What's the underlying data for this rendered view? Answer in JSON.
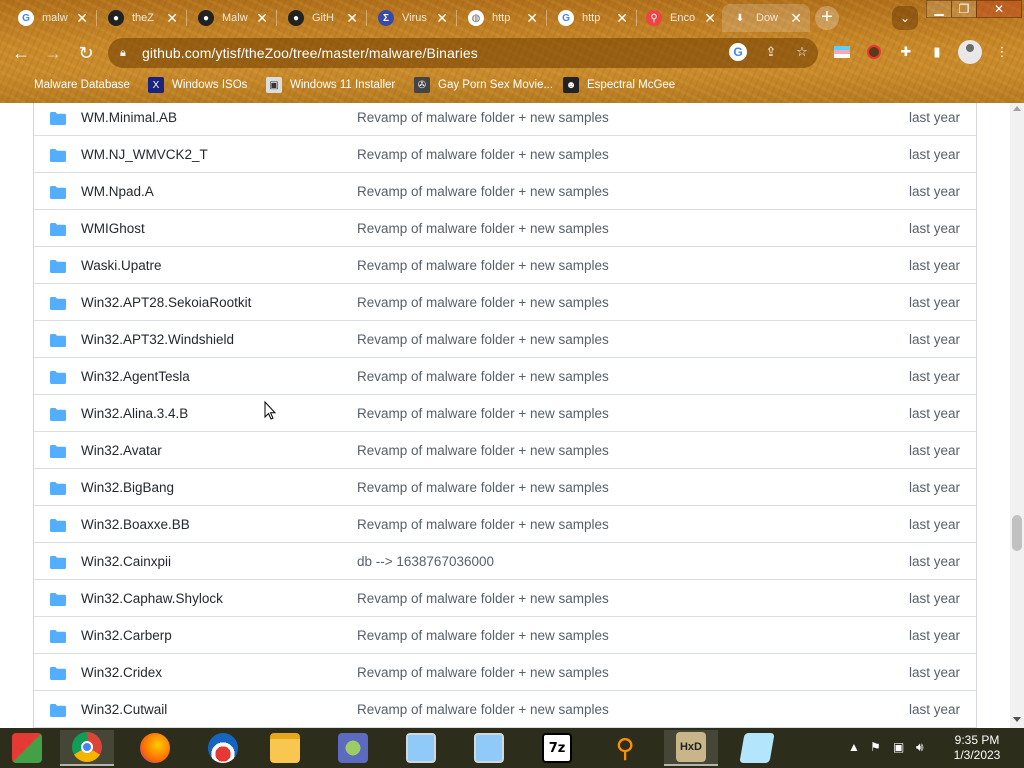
{
  "browser": {
    "tabs": [
      {
        "label": "malw",
        "icon": "google-icon"
      },
      {
        "label": "theZ",
        "icon": "github-icon"
      },
      {
        "label": "Malw",
        "icon": "github-icon"
      },
      {
        "label": "GitH",
        "icon": "github-icon"
      },
      {
        "label": "Virus",
        "icon": "virustotal-icon"
      },
      {
        "label": "http",
        "icon": "globe-icon"
      },
      {
        "label": "http",
        "icon": "google-icon"
      },
      {
        "label": "Enco",
        "icon": "search-icon"
      },
      {
        "label": "Dow",
        "icon": "download-icon"
      }
    ],
    "close_glyph": "✕",
    "new_tab_glyph": "+",
    "url": "github.com/ytisf/theZoo/tree/master/malware/Binaries",
    "bookmarks": [
      {
        "label": "Malware Database"
      },
      {
        "label": "Windows ISOs"
      },
      {
        "label": "Windows 11 Installer"
      },
      {
        "label": "Gay Porn Sex Movie..."
      },
      {
        "label": "Espectral McGee"
      }
    ]
  },
  "files": [
    {
      "name": "WM.Minimal.AB",
      "message": "Revamp of malware folder + new samples",
      "age": "last year"
    },
    {
      "name": "WM.NJ_WMVCK2_T",
      "message": "Revamp of malware folder + new samples",
      "age": "last year"
    },
    {
      "name": "WM.Npad.A",
      "message": "Revamp of malware folder + new samples",
      "age": "last year"
    },
    {
      "name": "WMIGhost",
      "message": "Revamp of malware folder + new samples",
      "age": "last year"
    },
    {
      "name": "Waski.Upatre",
      "message": "Revamp of malware folder + new samples",
      "age": "last year"
    },
    {
      "name": "Win32.APT28.SekoiaRootkit",
      "message": "Revamp of malware folder + new samples",
      "age": "last year"
    },
    {
      "name": "Win32.APT32.Windshield",
      "message": "Revamp of malware folder + new samples",
      "age": "last year"
    },
    {
      "name": "Win32.AgentTesla",
      "message": "Revamp of malware folder + new samples",
      "age": "last year"
    },
    {
      "name": "Win32.Alina.3.4.B",
      "message": "Revamp of malware folder + new samples",
      "age": "last year"
    },
    {
      "name": "Win32.Avatar",
      "message": "Revamp of malware folder + new samples",
      "age": "last year"
    },
    {
      "name": "Win32.BigBang",
      "message": "Revamp of malware folder + new samples",
      "age": "last year"
    },
    {
      "name": "Win32.Boaxxe.BB",
      "message": "Revamp of malware folder + new samples",
      "age": "last year"
    },
    {
      "name": "Win32.Cainxpii",
      "message": "db --> 1638767036000",
      "age": "last year"
    },
    {
      "name": "Win32.Caphaw.Shylock",
      "message": "Revamp of malware folder + new samples",
      "age": "last year"
    },
    {
      "name": "Win32.Carberp",
      "message": "Revamp of malware folder + new samples",
      "age": "last year"
    },
    {
      "name": "Win32.Cridex",
      "message": "Revamp of malware folder + new samples",
      "age": "last year"
    },
    {
      "name": "Win32.Cutwail",
      "message": "Revamp of malware folder + new samples",
      "age": "last year"
    }
  ],
  "taskbar": {
    "items": [
      {
        "icon": "start-icon"
      },
      {
        "icon": "chrome-icon"
      },
      {
        "icon": "firefox-icon"
      },
      {
        "icon": "obama-icon"
      },
      {
        "icon": "file-explorer-icon"
      },
      {
        "icon": "network-icon"
      },
      {
        "icon": "remote-desktop-icon"
      },
      {
        "icon": "remote-desktop-icon"
      },
      {
        "icon": "7zip-icon",
        "label": "7z"
      },
      {
        "icon": "search-magnifier-icon"
      },
      {
        "icon": "hxd-icon",
        "label": "HxD"
      },
      {
        "icon": "notepad-icon"
      }
    ],
    "time": "9:35 PM",
    "date": "1/3/2023"
  },
  "colors": {
    "folder": "#54aeff",
    "link_text": "#24292f",
    "muted_text": "#57606a",
    "chrome_theme": "#c8892a",
    "taskbar": "#2d2d1c"
  }
}
